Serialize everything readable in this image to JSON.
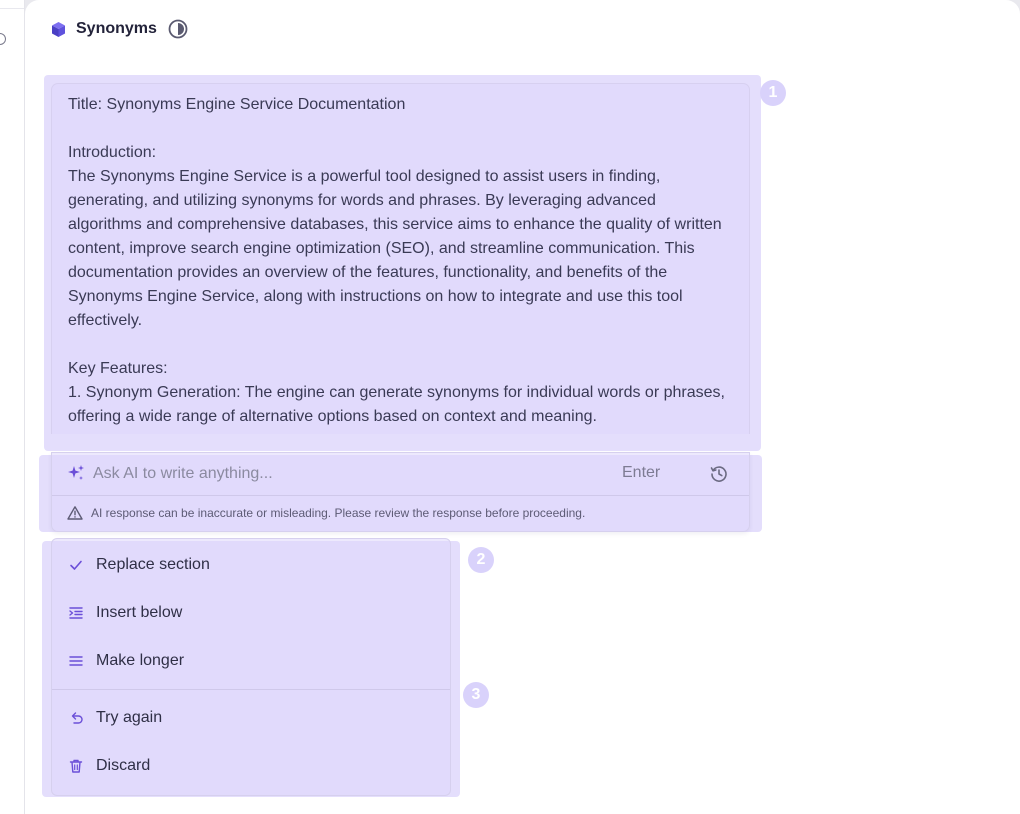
{
  "header": {
    "title": "Synonyms"
  },
  "document": {
    "paragraphs": [
      "Title: Synonyms Engine Service Documentation",
      "",
      "Introduction:",
      "The Synonyms Engine Service is a powerful tool designed to assist users in finding, generating, and utilizing synonyms for words and phrases. By leveraging advanced algorithms and comprehensive databases, this service aims to enhance the quality of written content, improve search engine optimization (SEO), and streamline communication. This documentation provides an overview of the features, functionality, and benefits of the Synonyms Engine Service, along with instructions on how to integrate and use this tool effectively.",
      "",
      "Key Features:",
      "1. Synonym Generation: The engine can generate synonyms for individual words or phrases, offering a wide range of alternative options based on context and meaning."
    ]
  },
  "ai_input": {
    "placeholder": "Ask AI to write anything...",
    "value": "",
    "enter_hint": "Enter",
    "warning": "AI response can be inaccurate or misleading. Please review the response before proceeding."
  },
  "menu": {
    "items": [
      {
        "label": "Replace section",
        "icon": "check-icon"
      },
      {
        "label": "Insert below",
        "icon": "insert-below-icon"
      },
      {
        "label": "Make longer",
        "icon": "lines-icon"
      },
      {
        "label": "Try again",
        "icon": "undo-icon"
      },
      {
        "label": "Discard",
        "icon": "trash-icon"
      }
    ]
  },
  "badges": [
    "1",
    "2",
    "3"
  ],
  "colors": {
    "accent": "#6b4fd8",
    "highlight": "#d9d2fb",
    "background": "#e9e9ee"
  }
}
